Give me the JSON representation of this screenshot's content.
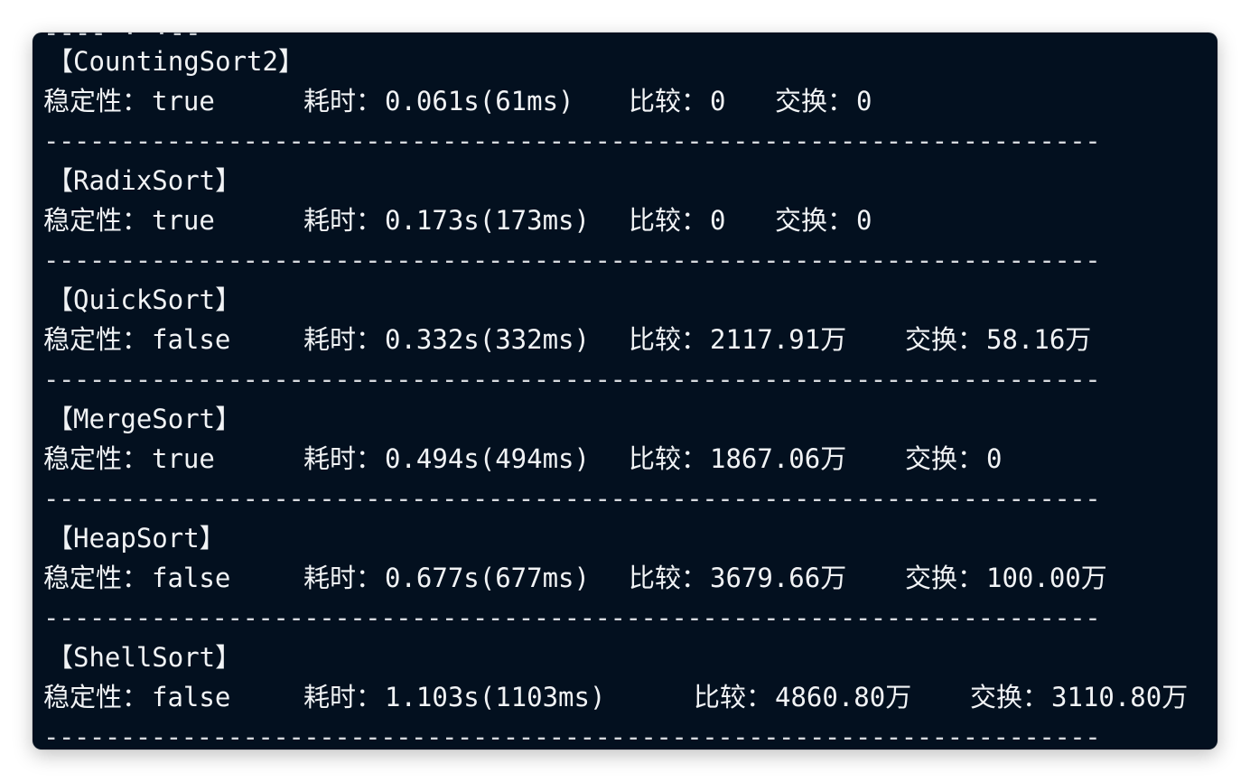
{
  "terminal": {
    "cut_line_text": "---- · ·--",
    "separator": "---------------------------------------------------------------------",
    "labels": {
      "stable": "稳定性：",
      "time": "耗时：",
      "compare": "比较：",
      "swap": "交换："
    },
    "results": [
      {
        "name": "【CountingSort2】",
        "stable": "true",
        "time": "0.061s(61ms)",
        "compare": "0",
        "swap": "0"
      },
      {
        "name": "【RadixSort】",
        "stable": "true",
        "time": "0.173s(173ms)",
        "compare": "0",
        "swap": "0"
      },
      {
        "name": "【QuickSort】",
        "stable": "false",
        "time": "0.332s(332ms)",
        "compare": "2117.91万",
        "swap": "58.16万"
      },
      {
        "name": "【MergeSort】",
        "stable": "true",
        "time": "0.494s(494ms)",
        "compare": "1867.06万",
        "swap": "0"
      },
      {
        "name": "【HeapSort】",
        "stable": "false",
        "time": "0.677s(677ms)",
        "compare": "3679.66万",
        "swap": "100.00万"
      },
      {
        "name": "【ShellSort】",
        "stable": "false",
        "time": "1.103s(1103ms)",
        "compare": "4860.80万",
        "swap": "3110.80万"
      }
    ]
  }
}
